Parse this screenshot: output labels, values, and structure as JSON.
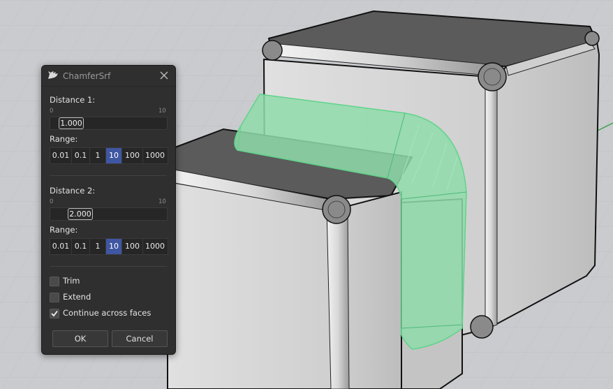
{
  "dialog": {
    "title": "ChamferSrf",
    "distance1": {
      "label": "Distance 1:",
      "min_label": "0",
      "max_label": "10",
      "value": "1.000",
      "range_label": "Range:",
      "range_options": [
        "0.01",
        "0.1",
        "1",
        "10",
        "100",
        "1000"
      ],
      "selected_range": "10"
    },
    "distance2": {
      "label": "Distance 2:",
      "min_label": "0",
      "max_label": "10",
      "value": "2.000",
      "range_label": "Range:",
      "range_options": [
        "0.01",
        "0.1",
        "1",
        "10",
        "100",
        "1000"
      ],
      "selected_range": "10"
    },
    "options": {
      "trim": {
        "label": "Trim",
        "checked": false
      },
      "extend": {
        "label": "Extend",
        "checked": false
      },
      "continue": {
        "label": "Continue across faces",
        "checked": true
      }
    },
    "ok_label": "OK",
    "cancel_label": "Cancel"
  },
  "theme": {
    "accent": "#3f56a2",
    "chamfer_highlight": "#8fdcaa",
    "box_face": "#d4d4d4",
    "box_top": "#5e5e5e"
  },
  "icons": {
    "app": "rhino-icon",
    "close": "close-icon",
    "check": "checkmark-icon"
  }
}
